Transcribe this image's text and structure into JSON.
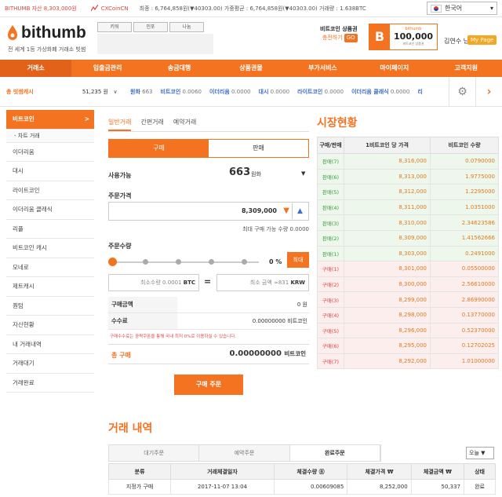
{
  "ticker": {
    "wallet_label": "BITHUMB 자산",
    "wallet_value": "8,303,000원",
    "coindex_label": "CXCoinCN",
    "high": "최종 : 6,764,858원(▼40303.00)",
    "avg": "가중평균 : 6,764,858원(▼40303.00)",
    "volume": "거래량 : 1.638BTC",
    "language": "한국어"
  },
  "header": {
    "logo": "bithumb",
    "tagline": "전 세계 1등 가상화폐 거래소 빗썸",
    "small_buttons": [
      "키워",
      "인포",
      "나눔"
    ],
    "promo_title": "비트코인 상품권",
    "promo_action": "충전하기",
    "promo_go": "GO",
    "coin_symbol": "B",
    "coin_brand": "bithumb",
    "coin_value": "100,000",
    "coin_caption": "비트코인 상품권",
    "user_name": "김연수 님",
    "mypage": "My Page"
  },
  "nav": [
    "거래소",
    "입출금관리",
    "송금대행",
    "상품권몰",
    "부가서비스",
    "마이페이지",
    "고객지원"
  ],
  "assets_bar": {
    "total_label": "총 빗썸캐시",
    "total_value": "51,235 원",
    "toggle": "∨",
    "items": [
      {
        "name": "원화",
        "value": "663"
      },
      {
        "name": "비트코인",
        "value": "0.0060"
      },
      {
        "name": "이더리움",
        "value": "0.0000"
      },
      {
        "name": "대시",
        "value": "0.0000"
      },
      {
        "name": "라이트코인",
        "value": "0.0000"
      },
      {
        "name": "이더리움 클래식",
        "value": "0.0000"
      },
      {
        "name": "리",
        "value": ""
      }
    ]
  },
  "sidebar": {
    "active": "비트코인",
    "active_arrow": ">",
    "sub": "- 차트 거래",
    "items": [
      "이더리움",
      "대시",
      "라이트코인",
      "이더리움 클래식",
      "리플",
      "비트코인 캐시",
      "모네로",
      "제트캐시",
      "퀀텀",
      "자산현황",
      "내 거래내역",
      "거래대기",
      "거래완료"
    ]
  },
  "order": {
    "tabs": [
      "일반거래",
      "간편거래",
      "예약거래"
    ],
    "buy": "구매",
    "sell": "판매",
    "available_label": "사용가능",
    "available_value": "663",
    "available_unit": "원화",
    "available_dd": "▼",
    "price_label": "주문가격",
    "price_value": "8,309,000",
    "max_info": "최대 구매 가능 수량 0.0000",
    "qty_label": "주문수량",
    "percent": "0 %",
    "max_btn": "최대",
    "min_qty_label": "최소수량 0.0001",
    "min_qty_unit": "BTC",
    "eq": "=",
    "min_amount_label": "최소 금액 ≈831",
    "min_amount_unit": "KRW",
    "rows": [
      {
        "k": "구매금액",
        "v": "0 원"
      },
      {
        "k": "수수료",
        "v": "0.00000000 비트코인"
      }
    ],
    "warning": "구매수수료는 쿵짝쿠폰을 통해 국내 최저 0%로 이용하실 수 있습니다.",
    "total_label": "총 구매",
    "total_value": "0.00000000",
    "total_unit": "비트코인",
    "submit": "구매 주문"
  },
  "market": {
    "title": "시장현황",
    "headers": [
      "구매/판매",
      "1비트코인 당 가격",
      "비트코인 수량"
    ],
    "rows": [
      {
        "side": "판매(7)",
        "price": "8,316,000",
        "qty": "0.0790000",
        "type": "sell"
      },
      {
        "side": "판매(6)",
        "price": "8,313,000",
        "qty": "1.9775000",
        "type": "sell"
      },
      {
        "side": "판매(5)",
        "price": "8,312,000",
        "qty": "1.2295000",
        "type": "sell"
      },
      {
        "side": "판매(4)",
        "price": "8,311,000",
        "qty": "1.0351000",
        "type": "sell"
      },
      {
        "side": "판매(3)",
        "price": "8,310,000",
        "qty": "2.34623586",
        "type": "sell"
      },
      {
        "side": "판매(2)",
        "price": "8,309,000",
        "qty": "1.41562666",
        "type": "sell"
      },
      {
        "side": "판매(1)",
        "price": "8,303,000",
        "qty": "0.2491000",
        "type": "sell"
      },
      {
        "side": "구매(1)",
        "price": "8,301,000",
        "qty": "0.05500000",
        "type": "buy"
      },
      {
        "side": "구매(2)",
        "price": "8,300,000",
        "qty": "2.56610000",
        "type": "buy"
      },
      {
        "side": "구매(3)",
        "price": "8,299,000",
        "qty": "2.86990000",
        "type": "buy"
      },
      {
        "side": "구매(4)",
        "price": "8,298,000",
        "qty": "0.13770000",
        "type": "buy"
      },
      {
        "side": "구매(5)",
        "price": "8,296,000",
        "qty": "0.52370000",
        "type": "buy"
      },
      {
        "side": "구매(6)",
        "price": "8,295,000",
        "qty": "0.12702025",
        "type": "buy"
      },
      {
        "side": "구매(7)",
        "price": "8,292,000",
        "qty": "1.01000000",
        "type": "buy"
      }
    ]
  },
  "history": {
    "title": "거래 내역",
    "tabs": [
      "대기주문",
      "예약주문",
      "완료주문"
    ],
    "day_select": "오늘 ▼",
    "headers": [
      "분류",
      "거래체결일자",
      "체결수량 Ⓑ",
      "체결가격 ₩",
      "체결금액 ₩",
      "상태"
    ],
    "rows": [
      [
        "지정가 구매",
        "2017-11-07 13:04",
        "0.00609085",
        "8,252,000",
        "50,337",
        "완료"
      ]
    ]
  },
  "colors": {
    "accent": "#f37321",
    "sell_bg": "#eef7ec",
    "buy_bg": "#fdeeee"
  }
}
